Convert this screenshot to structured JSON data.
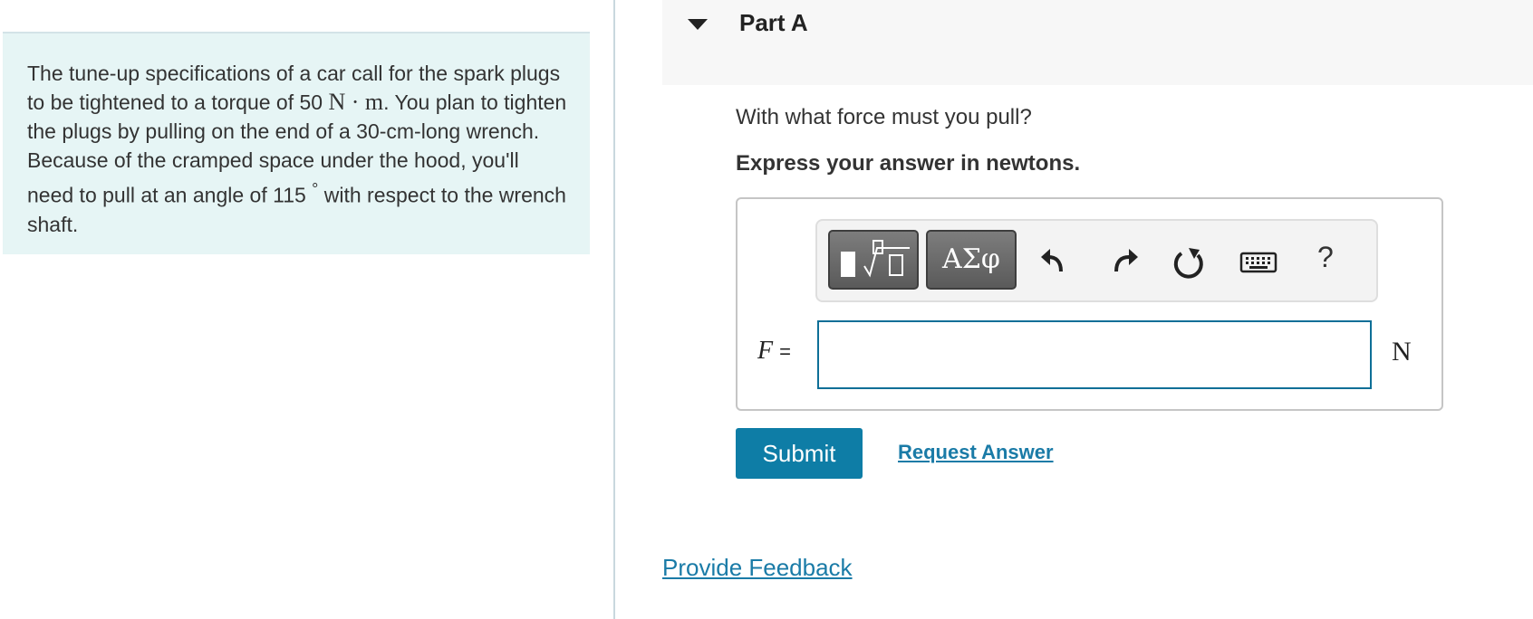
{
  "problem": {
    "text_part1": "The tune-up specifications of a car call for the spark plugs to be tightened to a torque of 50 ",
    "torque_unit": "N · m",
    "text_part2": ". You plan to tighten the plugs by pulling on the end of a 30-cm-long wrench. Because of the cramped space under the hood, you'll need to pull at an angle of 115 ",
    "degree_symbol": "°",
    "text_part3": " with respect to the wrench shaft."
  },
  "part": {
    "title": "Part A",
    "question": "With what force must you pull?",
    "instruction": "Express your answer in newtons."
  },
  "toolbar": {
    "greek_label": "ΑΣφ",
    "help_label": "?",
    "icons": [
      "templates-icon",
      "undo-icon",
      "redo-icon",
      "reset-icon",
      "keyboard-icon",
      "help-icon"
    ]
  },
  "answer": {
    "variable": "F",
    "equals": "=",
    "value": "",
    "unit": "N"
  },
  "actions": {
    "submit_label": "Submit",
    "request_label": "Request Answer",
    "feedback_label": "Provide Feedback"
  },
  "colors": {
    "accent": "#0e7da6",
    "link": "#1a7ba7",
    "problem_bg": "#e6f5f5"
  }
}
